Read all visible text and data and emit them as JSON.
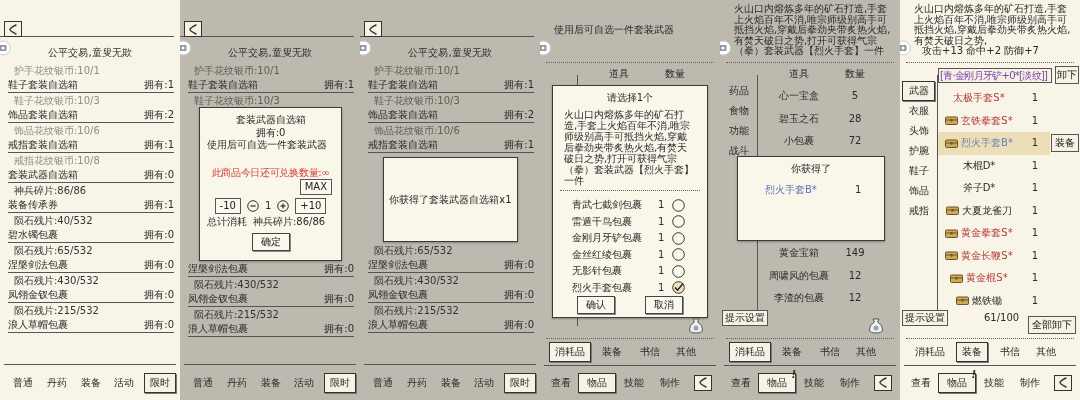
{
  "panels": [
    {
      "kind": "shop",
      "dimmed": false,
      "title": "公平交易,童叟无欺",
      "entries": [
        {
          "kind": "item",
          "cost": "护手花纹银币:10/1",
          "greyed": true,
          "name": "鞋子套装自选箱",
          "owned": "拥有:1"
        },
        {
          "kind": "item",
          "cost": "鞋子花纹银币:10/3",
          "greyed": true,
          "name": "饰品套装自选箱",
          "owned": "拥有:2"
        },
        {
          "kind": "item",
          "cost": "饰品花纹银币:10/6",
          "greyed": true,
          "name": "戒指套装自选箱",
          "owned": "拥有:1"
        },
        {
          "kind": "item",
          "cost": "戒指花纹银币:10/8",
          "greyed": true,
          "name": "套装武器自选箱",
          "owned": "拥有:0"
        },
        {
          "kind": "item",
          "cost": "神兵碎片:86/86",
          "greyed": false,
          "name": "装备传承券",
          "owned": "拥有:1"
        },
        {
          "kind": "item",
          "cost": "陨石残片:40/532",
          "greyed": false,
          "name": "碧水镯包裹",
          "owned": "拥有:0"
        },
        {
          "kind": "item",
          "cost": "陨石残片:65/532",
          "greyed": false,
          "name": "涅槃剑法包裹",
          "owned": "拥有:0"
        },
        {
          "kind": "item",
          "cost": "陨石残片:430/532",
          "greyed": false,
          "name": "凤翎金钗包裹",
          "owned": "拥有:0"
        },
        {
          "kind": "item",
          "cost": "陨石残片:215/532",
          "greyed": false,
          "name": "浪人草帽包裹",
          "owned": "拥有:0"
        }
      ],
      "tabs": [
        {
          "label": "普通",
          "selected": false
        },
        {
          "label": "丹药",
          "selected": false
        },
        {
          "label": "装备",
          "selected": false
        },
        {
          "label": "活动",
          "selected": false
        },
        {
          "label": "限时",
          "selected": true
        }
      ]
    },
    {
      "kind": "shop",
      "dimmed": true,
      "title": "公平交易,童叟无欺",
      "entries": [
        {
          "kind": "item",
          "cost": "护手花纹银币:10/1",
          "greyed": true,
          "name": "鞋子套装自选箱",
          "owned": "拥有:1"
        },
        {
          "kind": "item",
          "cost": "鞋子花纹银币:10/3",
          "greyed": true
        },
        {
          "kind": "dialog",
          "dialog": {
            "kind": "exchange",
            "title": "套装武器自选箱",
            "owned": "拥有:0",
            "description": "使用后可自选一件套装武器",
            "limit_note": "此商品今日还可兑换数量:∞",
            "max_button": "MAX",
            "minus_ten": "-10",
            "quantity": "1",
            "plus_ten": "+10",
            "total_label": "总计消耗",
            "total_cost": "神兵碎片:86/86",
            "confirm": "确定"
          }
        },
        {
          "kind": "item",
          "name": "涅槃剑法包裹",
          "owned": "拥有:0"
        },
        {
          "kind": "item",
          "cost": "陨石残片:430/532",
          "greyed": false,
          "name": "凤翎金钗包裹",
          "owned": "拥有:0"
        },
        {
          "kind": "item",
          "cost": "陨石残片:215/532",
          "greyed": false,
          "name": "浪人草帽包裹",
          "owned": "拥有:0"
        }
      ],
      "tabs": [
        {
          "label": "普通",
          "selected": false
        },
        {
          "label": "丹药",
          "selected": false
        },
        {
          "label": "装备",
          "selected": false
        },
        {
          "label": "活动",
          "selected": false
        },
        {
          "label": "限时",
          "selected": true
        }
      ]
    },
    {
      "kind": "shop",
      "dimmed": true,
      "title": "公平交易,童叟无欺",
      "entries": [
        {
          "kind": "item",
          "cost": "护手花纹银币:10/1",
          "greyed": true,
          "name": "鞋子套装自选箱",
          "owned": "拥有:1"
        },
        {
          "kind": "item",
          "cost": "鞋子花纹银币:10/3",
          "greyed": true,
          "name": "饰品套装自选箱",
          "owned": "拥有:2"
        },
        {
          "kind": "item",
          "cost": "饰品花纹银币:10/6",
          "greyed": true,
          "name": "戒指套装自选箱",
          "owned": "拥有:1"
        },
        {
          "kind": "dialog",
          "dialog": {
            "kind": "notice",
            "message": "你获得了套装武器自选箱x1"
          }
        },
        {
          "kind": "item",
          "cost": "陨石残片:65/532",
          "greyed": false,
          "name": "涅槃剑法包裹",
          "owned": "拥有:0"
        },
        {
          "kind": "item",
          "cost": "陨石残片:430/532",
          "greyed": false,
          "name": "凤翎金钗包裹",
          "owned": "拥有:0"
        },
        {
          "kind": "item",
          "cost": "陨石残片:215/532",
          "greyed": false,
          "name": "浪人草帽包裹",
          "owned": "拥有:0"
        }
      ],
      "tabs": [
        {
          "label": "普通",
          "selected": false
        },
        {
          "label": "丹药",
          "selected": false
        },
        {
          "label": "装备",
          "selected": false
        },
        {
          "label": "活动",
          "selected": false
        },
        {
          "label": "限时",
          "selected": true
        }
      ]
    },
    {
      "kind": "bag",
      "dimmed": true,
      "description": "使用后可自选一件套装武器",
      "columns": [
        "道具",
        "数量"
      ],
      "entries": [
        {
          "kind": "dialog",
          "dialog": {
            "kind": "choose",
            "title": "请选择1个",
            "description": "火山口内熔炼多年的矿石打造,手套上火焰百年不消,唯宗师级别高手可抵挡火焰,穿戴后拳劲夹带炙热火焰,有焚天破日之势,打开可获得气宗（拳）套装武器【烈火手套】一件",
            "options": [
              {
                "name": "青武七截剑包裹",
                "count": "1",
                "selected": false
              },
              {
                "name": "雷遁千鸟包裹",
                "count": "1",
                "selected": false
              },
              {
                "name": "金刚月牙铲包裹",
                "count": "1",
                "selected": false
              },
              {
                "name": "金丝红绫包裹",
                "count": "1",
                "selected": false
              },
              {
                "name": "无影针包裹",
                "count": "1",
                "selected": false
              },
              {
                "name": "烈火手套包裹",
                "count": "1",
                "selected": true
              }
            ],
            "confirm": "确认",
            "cancel": "取消"
          }
        }
      ],
      "pouch": true,
      "subtabs": [
        {
          "label": "消耗品",
          "selected": true
        },
        {
          "label": "装备",
          "selected": false
        },
        {
          "label": "书信",
          "selected": false
        },
        {
          "label": "其他",
          "selected": false
        }
      ],
      "nav": [
        {
          "label": "查看",
          "selected": false
        },
        {
          "label": "物品",
          "selected": true
        },
        {
          "label": "技能",
          "selected": false
        },
        {
          "label": "制作",
          "selected": false
        }
      ]
    },
    {
      "kind": "bag",
      "dimmed": true,
      "description": "火山口内熔炼多年的矿石打造,手套上火焰百年不消,唯宗师级别高手可抵挡火焰,穿戴后拳劲夹带炙热火焰,有焚天破日之势,打开可获得气宗（拳）套装武器【烈火手套】一件",
      "categories": [
        {
          "label": "药品",
          "selected": false
        },
        {
          "label": "食物",
          "selected": false
        },
        {
          "label": "功能",
          "selected": false
        },
        {
          "label": "战斗",
          "selected": false
        }
      ],
      "settings_button": "提示设置",
      "columns": [
        "道具",
        "数量"
      ],
      "entries": [
        {
          "kind": "item",
          "name": "心一宝盒",
          "count": "5"
        },
        {
          "kind": "item",
          "name": "碧玉之石",
          "count": "28"
        },
        {
          "kind": "item",
          "name": "小包裹",
          "count": "72"
        },
        {
          "kind": "dialog",
          "dialog": {
            "kind": "reward",
            "title": "你获得了",
            "item": "烈火手套B*",
            "count": "1"
          }
        },
        {
          "kind": "item",
          "name": "黄金宝箱",
          "count": "149"
        },
        {
          "kind": "item",
          "name": "周啸风的包裹",
          "count": "12"
        },
        {
          "kind": "item",
          "name": "李渣的包裹",
          "count": "12"
        }
      ],
      "pouch": true,
      "subtabs": [
        {
          "label": "消耗品",
          "selected": true
        },
        {
          "label": "装备",
          "selected": false
        },
        {
          "label": "书信",
          "selected": false
        },
        {
          "label": "其他",
          "selected": false
        }
      ],
      "nav": [
        {
          "label": "查看",
          "selected": false
        },
        {
          "label": "物品",
          "selected": true,
          "badge": "!"
        },
        {
          "label": "技能",
          "selected": false
        },
        {
          "label": "制作",
          "selected": false
        }
      ]
    },
    {
      "kind": "bag",
      "dimmed": false,
      "description": "火山口内熔炼多年的矿石打造,手套上火焰百年不消,唯宗师级别高手可抵挡火焰,穿戴后拳劲夹带炙热火焰,有焚天破日之势,",
      "stats": "攻击+13 命中+2 防御+7",
      "categories": [
        {
          "label": "武器",
          "selected": true
        },
        {
          "label": "衣服",
          "selected": false
        },
        {
          "label": "头饰",
          "selected": false
        },
        {
          "label": "护腕",
          "selected": false
        },
        {
          "label": "鞋子",
          "selected": false
        },
        {
          "label": "饰品",
          "selected": false
        },
        {
          "label": "戒指",
          "selected": false
        }
      ],
      "settings_button": "提示设置",
      "equipped": {
        "name": "[青·金刚月牙铲+0*[淡纹]]",
        "button": "卸下"
      },
      "entries": [
        {
          "kind": "item",
          "name": "太极手套S*",
          "count": "1",
          "color": "#b23b3b",
          "chest": false,
          "selected": false
        },
        {
          "kind": "item",
          "name": "玄铁拳套S*",
          "count": "1",
          "color": "#b23b3b",
          "chest": true,
          "selected": false
        },
        {
          "kind": "item",
          "name": "烈火手套B*",
          "count": "1",
          "color": "#6a7fb4",
          "chest": true,
          "selected": true,
          "action": "装备"
        },
        {
          "kind": "item",
          "name": "木棍D*",
          "count": "1",
          "chest": false,
          "selected": false
        },
        {
          "kind": "item",
          "name": "斧子D*",
          "count": "1",
          "chest": false,
          "selected": false
        },
        {
          "kind": "item",
          "name": "大夏龙雀刀",
          "count": "1",
          "chest": true,
          "selected": false
        },
        {
          "kind": "item",
          "name": "黄金拳套S*",
          "count": "1",
          "color": "#b23b3b",
          "chest": true,
          "selected": false
        },
        {
          "kind": "item",
          "name": "黄金长鞭S*",
          "count": "1",
          "color": "#b23b3b",
          "chest": true,
          "selected": false
        },
        {
          "kind": "item",
          "name": "黄金棍S*",
          "count": "1",
          "color": "#b23b3b",
          "chest": true,
          "selected": false
        },
        {
          "kind": "item",
          "name": "燃铁锄",
          "count": "1",
          "chest": true,
          "selected": false
        }
      ],
      "capacity": "61/100",
      "unequip_all": "全部卸下",
      "pouch": false,
      "subtabs": [
        {
          "label": "消耗品",
          "selected": false
        },
        {
          "label": "装备",
          "selected": true
        },
        {
          "label": "书信",
          "selected": false
        },
        {
          "label": "其他",
          "selected": false
        }
      ],
      "nav": [
        {
          "label": "查看",
          "selected": false
        },
        {
          "label": "物品",
          "selected": true,
          "badge": "!"
        },
        {
          "label": "技能",
          "selected": false
        },
        {
          "label": "制作",
          "selected": false
        }
      ]
    }
  ]
}
